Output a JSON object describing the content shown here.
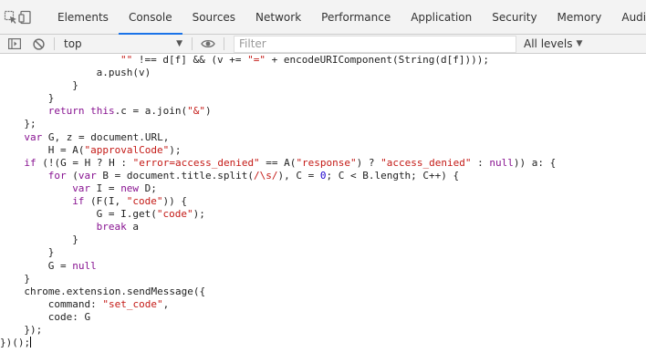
{
  "tabs": [
    {
      "label": "Elements",
      "selected": false
    },
    {
      "label": "Console",
      "selected": true
    },
    {
      "label": "Sources",
      "selected": false
    },
    {
      "label": "Network",
      "selected": false
    },
    {
      "label": "Performance",
      "selected": false
    },
    {
      "label": "Application",
      "selected": false
    },
    {
      "label": "Security",
      "selected": false
    },
    {
      "label": "Memory",
      "selected": false
    },
    {
      "label": "Audits",
      "selected": false
    }
  ],
  "toolbar": {
    "context": "top",
    "filter_placeholder": "Filter",
    "levels": "All levels"
  },
  "icons": {
    "inspect": "inspect-element-icon",
    "device": "device-toolbar-icon",
    "sidebar": "show-sidebar-icon",
    "clear": "clear-console-icon",
    "live_expression": "eye-icon"
  },
  "code_lines": [
    [
      [
        "\"\"",
        "str"
      ],
      [
        " !== d[f] && (v += ",
        ""
      ],
      [
        "\"=\"",
        "str"
      ],
      [
        " + encodeURIComponent(String(d[f])));",
        ""
      ]
    ],
    [
      [
        "a.push(v)",
        ""
      ]
    ],
    [
      [
        "}",
        ""
      ]
    ],
    [
      [
        "}",
        ""
      ]
    ],
    [
      [
        "return",
        "kw"
      ],
      [
        " ",
        ""
      ],
      [
        "this",
        "kw"
      ],
      [
        ".c = a.join(",
        ""
      ],
      [
        "\"&\"",
        "str"
      ],
      [
        ")",
        ""
      ]
    ],
    [
      [
        "};",
        ""
      ]
    ],
    [
      [
        "var",
        "kw"
      ],
      [
        " G, z = document.URL,",
        ""
      ]
    ],
    [
      [
        "H = A(",
        ""
      ],
      [
        "\"approvalCode\"",
        "str"
      ],
      [
        ");",
        ""
      ]
    ],
    [
      [
        "if",
        "kw"
      ],
      [
        " (!(G = H ? H : ",
        ""
      ],
      [
        "\"error=access_denied\"",
        "str"
      ],
      [
        " == A(",
        ""
      ],
      [
        "\"response\"",
        "str"
      ],
      [
        ") ? ",
        ""
      ],
      [
        "\"access_denied\"",
        "str"
      ],
      [
        " : ",
        ""
      ],
      [
        "null",
        "kw"
      ],
      [
        ")) a: {",
        ""
      ]
    ],
    [
      [
        "for",
        "kw"
      ],
      [
        " (",
        ""
      ],
      [
        "var",
        "kw"
      ],
      [
        " B = document.title.split(",
        ""
      ],
      [
        "/\\s/",
        "re"
      ],
      [
        "), C = ",
        ""
      ],
      [
        "0",
        "num"
      ],
      [
        "; C < B.length; C++) {",
        ""
      ]
    ],
    [
      [
        "var",
        "kw"
      ],
      [
        " I = ",
        ""
      ],
      [
        "new",
        "kw"
      ],
      [
        " D;",
        ""
      ]
    ],
    [
      [
        "if",
        "kw"
      ],
      [
        " (F(I, ",
        ""
      ],
      [
        "\"code\"",
        "str"
      ],
      [
        ")) {",
        ""
      ]
    ],
    [
      [
        "G = I.get(",
        ""
      ],
      [
        "\"code\"",
        "str"
      ],
      [
        ");",
        ""
      ]
    ],
    [
      [
        "break",
        "kw"
      ],
      [
        " a",
        ""
      ]
    ],
    [
      [
        "}",
        ""
      ]
    ],
    [
      [
        "}",
        ""
      ]
    ],
    [
      [
        "G = ",
        ""
      ],
      [
        "null",
        "kw"
      ]
    ],
    [
      [
        "}",
        ""
      ]
    ],
    [
      [
        "chrome.extension.sendMessage({",
        ""
      ]
    ],
    [
      [
        "command: ",
        ""
      ],
      [
        "\"set_code\"",
        "str"
      ],
      [
        ",",
        ""
      ]
    ],
    [
      [
        "code: G",
        ""
      ]
    ],
    [
      [
        "});",
        ""
      ]
    ],
    [
      [
        "})();",
        ""
      ]
    ]
  ],
  "code_indents": [
    16,
    12,
    8,
    4,
    4,
    0,
    0,
    4,
    0,
    4,
    8,
    8,
    12,
    12,
    8,
    4,
    4,
    0,
    0,
    4,
    4,
    0,
    -4
  ]
}
